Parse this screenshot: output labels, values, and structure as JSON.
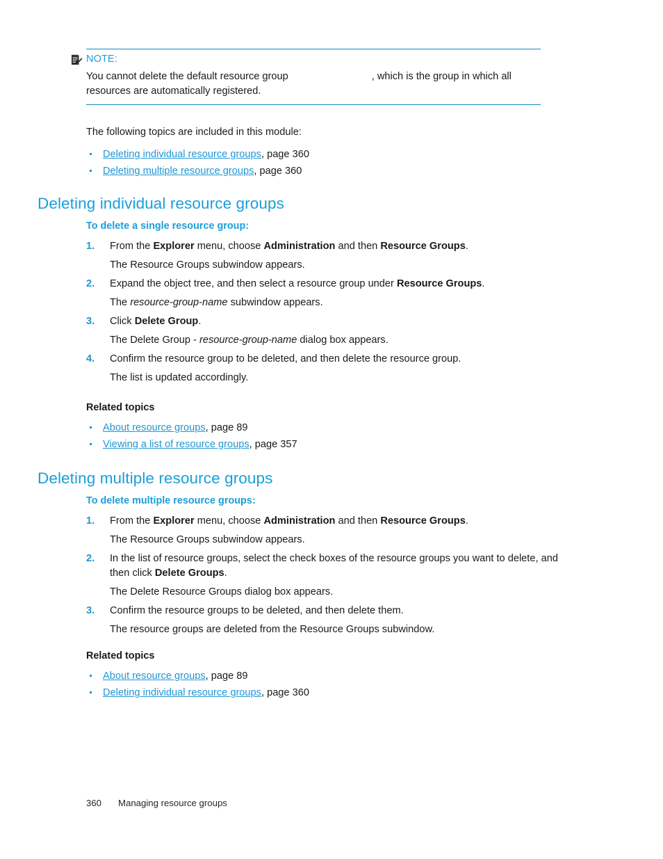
{
  "note": {
    "icon": "note-pad-pencil-icon",
    "label": "NOTE:",
    "text_before_blank": "You cannot delete the default resource group",
    "text_after_blank": ", which is the group in which all resources are automatically registered.",
    "rule_color": "#1588c0",
    "label_color": "#1a9fd9"
  },
  "intro": {
    "text": "The following topics are included in this module:",
    "links": [
      {
        "title": "Deleting individual resource groups",
        "page_ref": ", page 360"
      },
      {
        "title": "Deleting multiple resource groups",
        "page_ref": ", page 360"
      }
    ]
  },
  "sections": [
    {
      "heading": "Deleting individual resource groups",
      "subheading": "To delete a single resource group:",
      "steps": [
        {
          "num": "1.",
          "parts": [
            {
              "t": "From the ",
              "s": "plain"
            },
            {
              "t": "Explorer",
              "s": "bold"
            },
            {
              "t": " menu, choose ",
              "s": "plain"
            },
            {
              "t": "Administration",
              "s": "bold"
            },
            {
              "t": " and then ",
              "s": "plain"
            },
            {
              "t": "Resource Groups",
              "s": "bold"
            },
            {
              "t": ".",
              "s": "plain"
            }
          ],
          "result": [
            {
              "t": "The Resource Groups subwindow appears.",
              "s": "plain"
            }
          ]
        },
        {
          "num": "2.",
          "parts": [
            {
              "t": "Expand the object tree, and then select a resource group under ",
              "s": "plain"
            },
            {
              "t": "Resource Groups",
              "s": "bold"
            },
            {
              "t": ".",
              "s": "plain"
            }
          ],
          "result": [
            {
              "t": "The ",
              "s": "plain"
            },
            {
              "t": "resource-group-name",
              "s": "italic"
            },
            {
              "t": " subwindow appears.",
              "s": "plain"
            }
          ]
        },
        {
          "num": "3.",
          "parts": [
            {
              "t": "Click ",
              "s": "plain"
            },
            {
              "t": "Delete Group",
              "s": "bold"
            },
            {
              "t": ".",
              "s": "plain"
            }
          ],
          "result": [
            {
              "t": "The Delete Group - ",
              "s": "plain"
            },
            {
              "t": "resource-group-name",
              "s": "italic"
            },
            {
              "t": " dialog box appears.",
              "s": "plain"
            }
          ]
        },
        {
          "num": "4.",
          "parts": [
            {
              "t": "Confirm the resource group to be deleted, and then delete the resource group.",
              "s": "plain"
            }
          ],
          "result": [
            {
              "t": "The list is updated accordingly.",
              "s": "plain"
            }
          ]
        }
      ],
      "related_label": "Related topics",
      "related": [
        {
          "title": "About resource groups",
          "page_ref": ", page 89"
        },
        {
          "title": "Viewing a list of resource groups",
          "page_ref": ", page 357"
        }
      ]
    },
    {
      "heading": "Deleting multiple resource groups",
      "subheading": "To delete multiple resource groups:",
      "steps": [
        {
          "num": "1.",
          "parts": [
            {
              "t": "From the ",
              "s": "plain"
            },
            {
              "t": "Explorer",
              "s": "bold"
            },
            {
              "t": " menu, choose ",
              "s": "plain"
            },
            {
              "t": "Administration",
              "s": "bold"
            },
            {
              "t": " and then ",
              "s": "plain"
            },
            {
              "t": "Resource Groups",
              "s": "bold"
            },
            {
              "t": ".",
              "s": "plain"
            }
          ],
          "result": [
            {
              "t": "The Resource Groups subwindow appears.",
              "s": "plain"
            }
          ]
        },
        {
          "num": "2.",
          "parts": [
            {
              "t": "In the list of resource groups, select the check boxes of the resource groups you want to delete, and then click ",
              "s": "plain"
            },
            {
              "t": "Delete Groups",
              "s": "bold"
            },
            {
              "t": ".",
              "s": "plain"
            }
          ],
          "result": [
            {
              "t": "The Delete Resource Groups dialog box appears.",
              "s": "plain"
            }
          ]
        },
        {
          "num": "3.",
          "parts": [
            {
              "t": "Confirm the resource groups to be deleted, and then delete them.",
              "s": "plain"
            }
          ],
          "result": [
            {
              "t": "The resource groups are deleted from the Resource Groups subwindow.",
              "s": "plain"
            }
          ]
        }
      ],
      "related_label": "Related topics",
      "related": [
        {
          "title": "About resource groups",
          "page_ref": ", page 89"
        },
        {
          "title": "Deleting individual resource groups",
          "page_ref": ", page 360"
        }
      ]
    }
  ],
  "footer": {
    "page_number": "360",
    "chapter": "Managing resource groups"
  }
}
